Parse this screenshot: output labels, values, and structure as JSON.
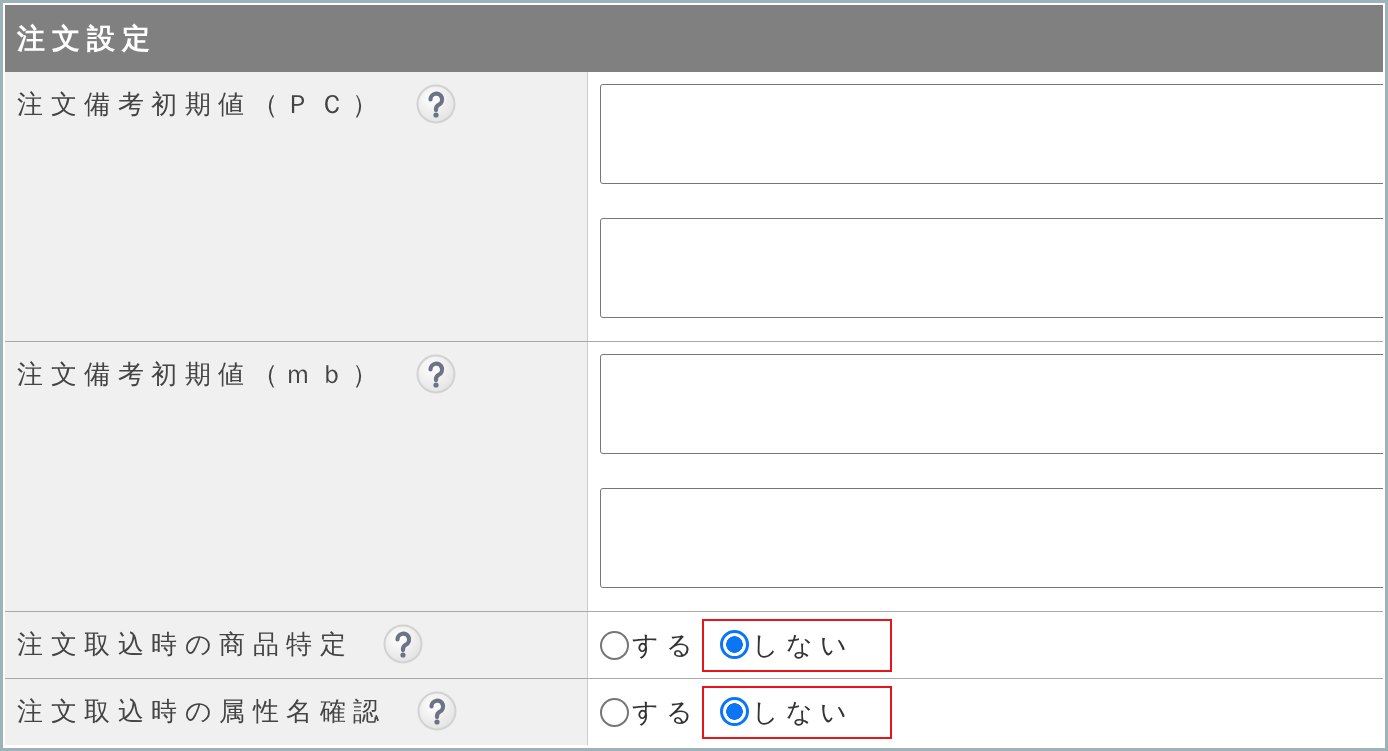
{
  "panel": {
    "title": "注文設定"
  },
  "rows": [
    {
      "kind": "textareas",
      "label": "注文備考初期値（ＰＣ）",
      "help_icon": true,
      "fields": [
        {
          "kind": "textarea"
        },
        {
          "kind": "textarea"
        }
      ]
    },
    {
      "kind": "textareas",
      "label": "注文備考初期値（ｍｂ）",
      "help_icon": true,
      "fields": [
        {
          "kind": "textarea"
        },
        {
          "kind": "textarea"
        }
      ]
    },
    {
      "kind": "radio",
      "label": "注文取込時の商品特定",
      "help_icon": true,
      "options": [
        {
          "label": "する",
          "selected": false,
          "highlighted": false
        },
        {
          "label": "しない",
          "selected": true,
          "highlighted": true
        }
      ]
    },
    {
      "kind": "radio",
      "label": "注文取込時の属性名確認",
      "help_icon": true,
      "options": [
        {
          "label": "する",
          "selected": false,
          "highlighted": false
        },
        {
          "label": "しない",
          "selected": true,
          "highlighted": true
        }
      ]
    }
  ]
}
